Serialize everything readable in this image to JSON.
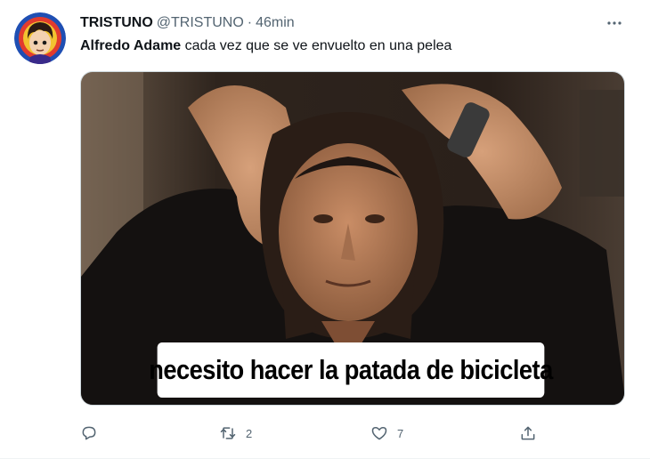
{
  "tweet": {
    "display_name": "TRISTUNO",
    "handle": "@TRISTUNO",
    "separator": "·",
    "time": "46min",
    "text_mention": "Alfredo Adame",
    "text_body": " cada vez que se ve envuelto en una pelea",
    "media_caption": "necesito hacer la patada de bicicleta"
  },
  "actions": {
    "reply_count": "",
    "retweet_count": "2",
    "like_count": "7"
  },
  "colors": {
    "text_primary": "#0f1419",
    "text_secondary": "#536471",
    "border": "#cfd9de"
  }
}
